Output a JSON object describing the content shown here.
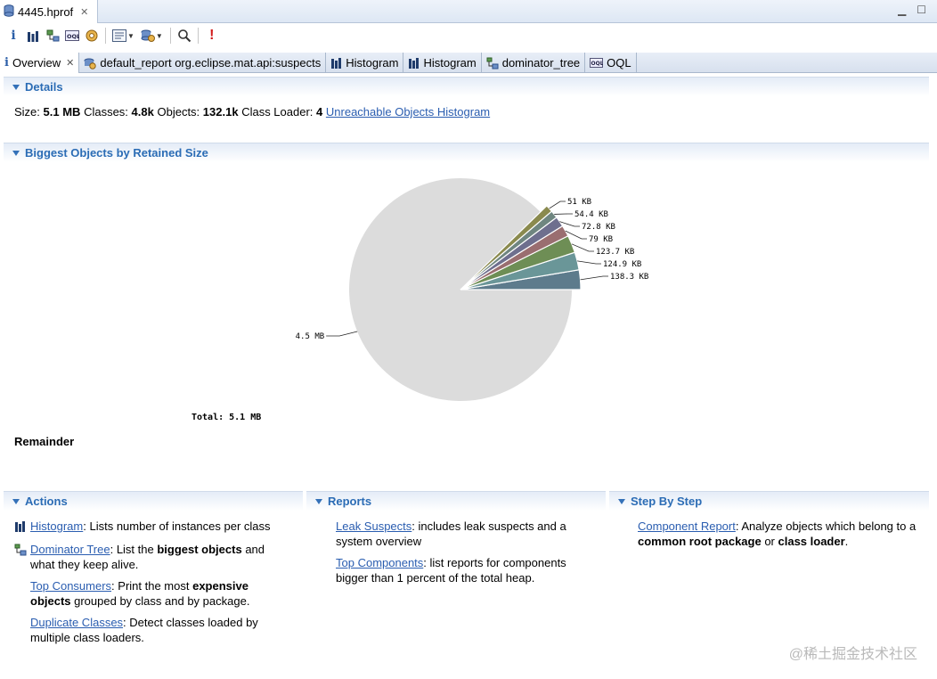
{
  "editor_tab": {
    "label": "4445.hprof"
  },
  "view_tabs": [
    {
      "label": "Overview"
    },
    {
      "label": "default_report  org.eclipse.mat.api:suspects"
    },
    {
      "label": "Histogram"
    },
    {
      "label": "Histogram"
    },
    {
      "label": "dominator_tree"
    },
    {
      "label": "OQL"
    }
  ],
  "toolbar": {
    "icons": [
      "info-icon",
      "histogram-icon",
      "dominator-tree-icon",
      "oql-icon",
      "heap-dump-overview-icon",
      "query-browser-icon",
      "reports-icon",
      "search-icon",
      "stop-icon"
    ]
  },
  "details": {
    "title": "Details",
    "size_label": "Size:",
    "size_value": "5.1 MB",
    "classes_label": "Classes:",
    "classes_value": "4.8k",
    "objects_label": "Objects:",
    "objects_value": "132.1k",
    "loader_label": "Class Loader:",
    "loader_value": "4",
    "link": "Unreachable Objects Histogram"
  },
  "biggest": {
    "title": "Biggest Objects by Retained Size",
    "total": "Total: 5.1 MB",
    "remainder": "Remainder"
  },
  "chart_data": {
    "type": "pie",
    "unit": "KB",
    "slices": [
      {
        "label": "138.3 KB",
        "value": 138.3,
        "color": "#5d7b8c"
      },
      {
        "label": "124.9 KB",
        "value": 124.9,
        "color": "#6a9698"
      },
      {
        "label": "123.7 KB",
        "value": 123.7,
        "color": "#6e8e55"
      },
      {
        "label": "79 KB",
        "value": 79,
        "color": "#9a6e70"
      },
      {
        "label": "72.8 KB",
        "value": 72.8,
        "color": "#6e6f8e"
      },
      {
        "label": "54.4 KB",
        "value": 54.4,
        "color": "#6f8680"
      },
      {
        "label": "51 KB",
        "value": 51,
        "color": "#8a8a4e"
      },
      {
        "label": "4.5 MB",
        "value": 4608,
        "color": "#dcdcdc"
      }
    ],
    "total": "Total: 5.1 MB"
  },
  "actions": {
    "title": "Actions",
    "items": [
      {
        "link": "Histogram",
        "rest": ": Lists number of instances per class",
        "icon": "histogram-icon"
      },
      {
        "link": "Dominator Tree",
        "rest_a": ": List the ",
        "bold": "biggest objects",
        "rest_b": " and what they keep alive.",
        "icon": "dominator-tree-icon"
      },
      {
        "link": "Top Consumers",
        "rest_a": ": Print the most ",
        "bold": "expensive objects",
        "rest_b": " grouped by class and by package."
      },
      {
        "link": "Duplicate Classes",
        "rest": ": Detect classes loaded by multiple class loaders."
      }
    ]
  },
  "reports": {
    "title": "Reports",
    "items": [
      {
        "link": "Leak Suspects",
        "rest": ": includes leak suspects and a system overview"
      },
      {
        "link": "Top Components",
        "rest": ": list reports for components bigger than 1 percent of the total heap."
      }
    ]
  },
  "step": {
    "title": "Step By Step",
    "items": [
      {
        "link": "Component Report",
        "rest_a": ": Analyze objects which belong to a ",
        "bold1": "common root package",
        "mid": " or ",
        "bold2": "class loader",
        "rest_b": "."
      }
    ]
  },
  "watermark": "@稀土掘金技术社区"
}
